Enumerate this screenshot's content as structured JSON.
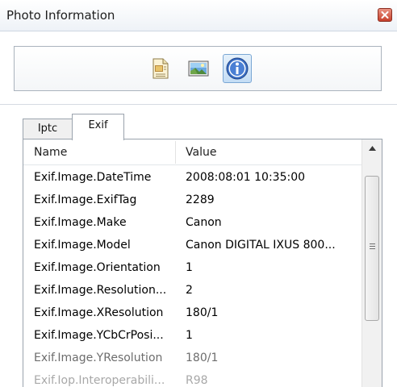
{
  "window": {
    "title": "Photo Information"
  },
  "toolbar": {
    "buttons": [
      {
        "icon": "document-icon",
        "selected": false
      },
      {
        "icon": "picture-icon",
        "selected": false
      },
      {
        "icon": "info-icon",
        "selected": true
      }
    ]
  },
  "tabs": [
    {
      "label": "Iptc",
      "active": false
    },
    {
      "label": "Exif",
      "active": true
    }
  ],
  "table": {
    "columns": [
      "Name",
      "Value"
    ],
    "rows": [
      {
        "name": "Exif.Image.DateTime",
        "value": "2008:08:01 10:35:00"
      },
      {
        "name": "Exif.Image.ExifTag",
        "value": "2289"
      },
      {
        "name": "Exif.Image.Make",
        "value": "Canon"
      },
      {
        "name": "Exif.Image.Model",
        "value": "Canon DIGITAL IXUS 800..."
      },
      {
        "name": "Exif.Image.Orientation",
        "value": "1"
      },
      {
        "name": "Exif.Image.Resolution...",
        "value": "2"
      },
      {
        "name": "Exif.Image.XResolution",
        "value": "180/1"
      },
      {
        "name": "Exif.Image.YCbCrPosi...",
        "value": "1"
      },
      {
        "name": "Exif.Image.YResolution",
        "value": "180/1"
      },
      {
        "name": "Exif.Iop.Interoperabili...",
        "value": "R98"
      }
    ]
  },
  "colors": {
    "text": "#1e1e1e",
    "faded_text_1": "#6d6d6d",
    "faded_text_2": "#a8a8a8",
    "accent": "#3b6fc4"
  }
}
